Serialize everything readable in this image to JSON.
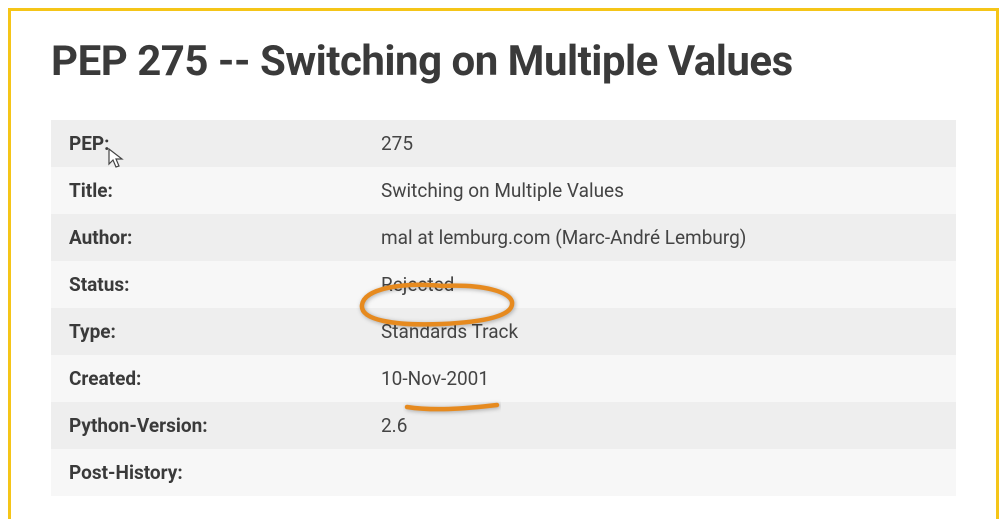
{
  "title": "PEP 275 -- Switching on Multiple Values",
  "rows": [
    {
      "label": "PEP:",
      "value": "275"
    },
    {
      "label": "Title:",
      "value": "Switching on Multiple Values"
    },
    {
      "label": "Author:",
      "value": "mal at lemburg.com (Marc-André Lemburg)"
    },
    {
      "label": "Status:",
      "value": "Rejected"
    },
    {
      "label": "Type:",
      "value": "Standards Track"
    },
    {
      "label": "Created:",
      "value": "10-Nov-2001"
    },
    {
      "label": "Python-Version:",
      "value": "2.6"
    },
    {
      "label": "Post-History:",
      "value": ""
    }
  ]
}
